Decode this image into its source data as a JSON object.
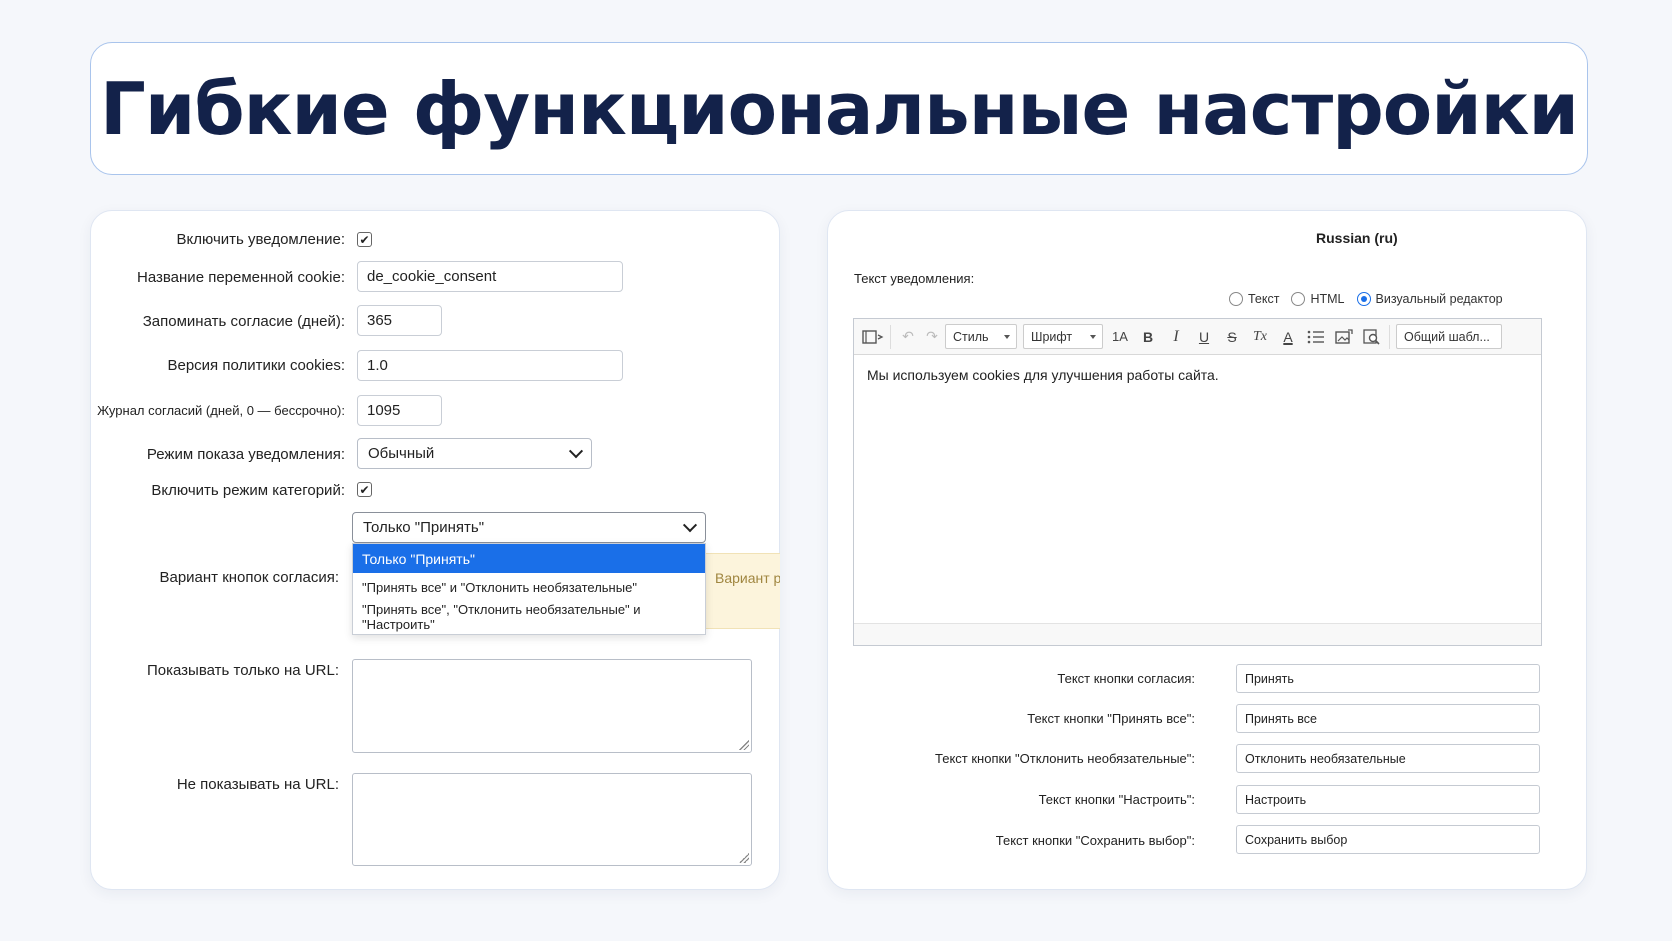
{
  "title": "Гибкие функциональные настройки",
  "left_form": {
    "enable_notification_label": "Включить уведомление:",
    "enable_notification_checked": true,
    "cookie_name_label": "Название переменной cookie:",
    "cookie_name_value": "de_cookie_consent",
    "remember_days_label": "Запоминать согласие (дней):",
    "remember_days_value": "365",
    "policy_version_label": "Версия политики cookies:",
    "policy_version_value": "1.0",
    "consent_log_label": "Журнал согласий (дней, 0 — бессрочно):",
    "consent_log_value": "1095",
    "display_mode_label": "Режим показа уведомления:",
    "display_mode_value": "Обычный",
    "categories_mode_label": "Включить режим категорий:",
    "categories_mode_checked": true,
    "buttons_variant_label": "Вариант кнопок согласия:",
    "buttons_variant_value": "Только \"Принять\"",
    "buttons_variant_options": [
      "Только \"Принять\"",
      "\"Принять все\" и \"Отклонить необязательные\"",
      "\"Принять все\", \"Отклонить необязательные\" и \"Настроить\""
    ],
    "hint_text": "Вариант р",
    "show_only_url_label": "Показывать только на URL:",
    "hide_url_label": "Не показывать на URL:"
  },
  "right_form": {
    "language": "Russian (ru)",
    "notification_text_label": "Текст уведомления:",
    "modes": [
      {
        "label": "Текст",
        "selected": false
      },
      {
        "label": "HTML",
        "selected": false
      },
      {
        "label": "Визуальный редактор",
        "selected": true
      }
    ],
    "toolbar": {
      "style_label": "Стиль",
      "font_label": "Шрифт",
      "size_label": "1A",
      "bold": "B",
      "italic": "I",
      "underline": "U",
      "strike": "S",
      "clear_format": "Tx",
      "font_color": "A",
      "template_label": "Общий шабл..."
    },
    "editor_content": "Мы используем cookies для улучшения работы сайта.",
    "fields": [
      {
        "label": "Текст кнопки согласия:",
        "value": "Принять"
      },
      {
        "label": "Текст кнопки \"Принять все\":",
        "value": "Принять все"
      },
      {
        "label": "Текст кнопки \"Отклонить необязательные\":",
        "value": "Отклонить необязательные"
      },
      {
        "label": "Текст кнопки \"Настроить\":",
        "value": "Настроить"
      },
      {
        "label": "Текст кнопки \"Сохранить выбор\":",
        "value": "Сохранить выбор"
      }
    ]
  },
  "colors": {
    "accent": "#1a6fe8",
    "title": "#13224a",
    "hint_bg": "#fcf4dc"
  }
}
